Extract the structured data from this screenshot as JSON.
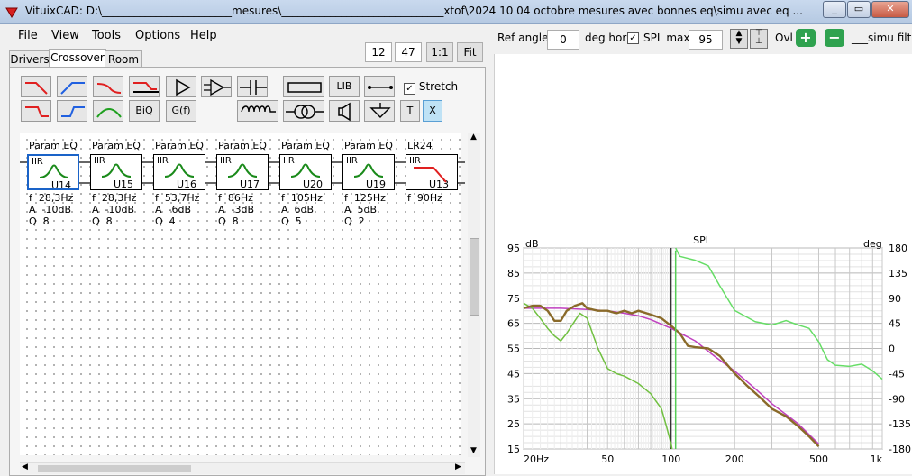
{
  "window": {
    "title": "VituixCAD: D:\\________________________mesures\\______________________________xtof\\2024 10 04 octobre mesures avec bonnes eq\\simu avec eq ...",
    "minimize": "_",
    "maximize": "▭",
    "close": "✕"
  },
  "menu": [
    "File",
    "View",
    "Tools",
    "Options",
    "Help"
  ],
  "toolbar": {
    "grid_x": "12",
    "grid_y": "47",
    "one_to_one": "1:1",
    "fit": "Fit"
  },
  "tabs": [
    {
      "label": "Drivers"
    },
    {
      "label": "Crossover",
      "active": true
    },
    {
      "label": "Room"
    }
  ],
  "palette": {
    "lib": "LIB",
    "biq": "BiQ",
    "gf": "G(f)",
    "t": "T",
    "x": "X",
    "stretch_label": "Stretch",
    "stretch_checked": true
  },
  "components": [
    {
      "title": "Param EQ",
      "type": "IIR",
      "id": "U14",
      "f": "f  28,3Hz",
      "a": "A  -10dB",
      "q": "Q  8",
      "selected": true
    },
    {
      "title": "Param EQ",
      "type": "IIR",
      "id": "U15",
      "f": "f  28,3Hz",
      "a": "A  -10dB",
      "q": "Q  8"
    },
    {
      "title": "Param EQ",
      "type": "IIR",
      "id": "U16",
      "f": "f  53,7Hz",
      "a": "A  -6dB",
      "q": "Q  4"
    },
    {
      "title": "Param EQ",
      "type": "IIR",
      "id": "U17",
      "f": "f  86Hz",
      "a": "A  -3dB",
      "q": "Q  8"
    },
    {
      "title": "Param EQ",
      "type": "IIR",
      "id": "U20",
      "f": "f  105Hz",
      "a": "A  6dB",
      "q": "Q  5"
    },
    {
      "title": "Param EQ",
      "type": "IIR",
      "id": "U19",
      "f": "f  125Hz",
      "a": "A  5dB",
      "q": "Q  2"
    },
    {
      "title": "LR24",
      "type": "IIR",
      "id": "U13",
      "f": "f  90Hz",
      "a": "",
      "q": ""
    }
  ],
  "right_toolbar": {
    "ref_angle_label": "Ref angle",
    "ref_angle_value": "0",
    "deg_hor_label": "deg hor",
    "spl_max_label": "SPL max",
    "spl_max_checked": true,
    "spl_max_value": "95",
    "ovl_label": "Ovl",
    "plus": "+",
    "minus": "−",
    "overlay_name": "___simu  filtre"
  },
  "chart_data": {
    "type": "line",
    "title": "SPL",
    "ylabel_left": "dB",
    "ylabel_right": "deg",
    "x_scale": "log",
    "xlim": [
      20,
      1000
    ],
    "ylim": [
      15,
      95
    ],
    "y2lim": [
      -180,
      180
    ],
    "x_ticks": [
      "20Hz",
      "50",
      "100",
      "200",
      "500",
      "1k"
    ],
    "x_tick_values": [
      20,
      50,
      100,
      200,
      500,
      1000
    ],
    "y_ticks": [
      "95",
      "85",
      "75",
      "65",
      "55",
      "45",
      "35",
      "25",
      "15"
    ],
    "y2_ticks": [
      "180",
      "135",
      "90",
      "45",
      "0",
      "-45",
      "-90",
      "-135",
      "-180"
    ],
    "grid": true,
    "colors": {
      "spl_total": "#8a6a2a",
      "target": "#c040c0",
      "phase": "#66dd66",
      "spl_green": "#70c040",
      "marker": "#000000"
    },
    "series": [
      {
        "color": "#c040c0",
        "points": [
          [
            20,
            71
          ],
          [
            30,
            71
          ],
          [
            40,
            70.5
          ],
          [
            50,
            70
          ],
          [
            60,
            69
          ],
          [
            70,
            68
          ],
          [
            80,
            66.5
          ],
          [
            100,
            63
          ],
          [
            130,
            58
          ],
          [
            160,
            52
          ],
          [
            200,
            46
          ],
          [
            250,
            39
          ],
          [
            300,
            33
          ],
          [
            400,
            25
          ],
          [
            500,
            17
          ]
        ]
      },
      {
        "color": "#70c040",
        "points": [
          [
            20,
            73
          ],
          [
            22,
            71
          ],
          [
            24,
            67
          ],
          [
            26,
            63
          ],
          [
            28,
            60
          ],
          [
            30,
            58
          ],
          [
            32,
            61
          ],
          [
            35,
            66
          ],
          [
            37,
            69
          ],
          [
            40,
            67
          ],
          [
            45,
            55
          ],
          [
            50,
            47
          ],
          [
            55,
            45
          ],
          [
            60,
            44
          ],
          [
            70,
            41
          ],
          [
            80,
            37
          ],
          [
            90,
            31
          ],
          [
            95,
            24
          ],
          [
            100,
            17
          ],
          [
            101,
            15
          ]
        ]
      },
      {
        "color": "#8a6a2a",
        "points": [
          [
            20,
            71
          ],
          [
            22,
            72
          ],
          [
            24,
            72
          ],
          [
            26,
            70
          ],
          [
            28,
            66
          ],
          [
            30,
            66
          ],
          [
            32,
            70
          ],
          [
            35,
            72
          ],
          [
            38,
            73
          ],
          [
            40,
            71
          ],
          [
            45,
            70
          ],
          [
            50,
            70
          ],
          [
            55,
            69
          ],
          [
            60,
            70
          ],
          [
            65,
            69
          ],
          [
            70,
            70
          ],
          [
            80,
            68.5
          ],
          [
            90,
            67
          ],
          [
            100,
            64
          ],
          [
            110,
            61
          ],
          [
            120,
            56
          ],
          [
            130,
            55.5
          ],
          [
            150,
            55
          ],
          [
            170,
            52
          ],
          [
            200,
            45
          ],
          [
            230,
            40
          ],
          [
            260,
            36
          ],
          [
            300,
            31
          ],
          [
            350,
            28
          ],
          [
            400,
            24
          ],
          [
            450,
            20
          ],
          [
            500,
            16
          ]
        ]
      },
      {
        "color": "#66dd66",
        "axis": "right",
        "points": [
          [
            105,
            180
          ],
          [
            110,
            165
          ],
          [
            130,
            158
          ],
          [
            150,
            148
          ],
          [
            170,
            112
          ],
          [
            200,
            68
          ],
          [
            250,
            48
          ],
          [
            300,
            42
          ],
          [
            350,
            50
          ],
          [
            400,
            42
          ],
          [
            450,
            36
          ],
          [
            500,
            12
          ],
          [
            550,
            -20
          ],
          [
            600,
            -30
          ],
          [
            700,
            -32
          ],
          [
            800,
            -28
          ],
          [
            900,
            -40
          ],
          [
            1000,
            -55
          ]
        ]
      },
      {
        "color": "#55cc55",
        "points": [
          [
            105,
            15
          ],
          [
            105,
            94
          ]
        ]
      }
    ],
    "marker_x": 100
  }
}
